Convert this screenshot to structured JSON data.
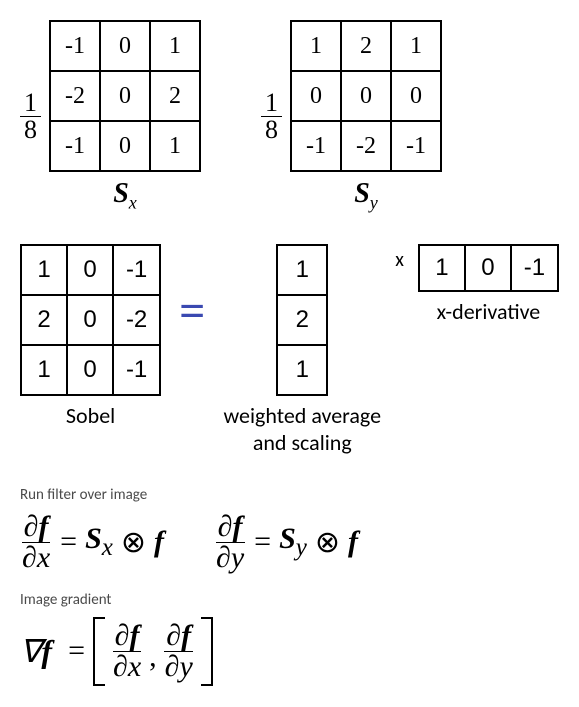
{
  "fraction": {
    "num": "1",
    "den": "8"
  },
  "sx": {
    "label": "S",
    "sub": "x",
    "cells": [
      [
        "-1",
        "0",
        "1"
      ],
      [
        "-2",
        "0",
        "2"
      ],
      [
        "-1",
        "0",
        "1"
      ]
    ]
  },
  "sy": {
    "label": "S",
    "sub": "y",
    "cells": [
      [
        "1",
        "2",
        "1"
      ],
      [
        "0",
        "0",
        "0"
      ],
      [
        "-1",
        "-2",
        "-1"
      ]
    ]
  },
  "sobel": {
    "label": "Sobel",
    "cells": [
      [
        "1",
        "0",
        "-1"
      ],
      [
        "2",
        "0",
        "-2"
      ],
      [
        "1",
        "0",
        "-1"
      ]
    ]
  },
  "decomp": {
    "eq": "=",
    "mult": "x",
    "col": [
      "1",
      "2",
      "1"
    ],
    "col_label": "weighted average and scaling",
    "row": [
      "1",
      "0",
      "-1"
    ],
    "row_label": "x-derivative"
  },
  "headings": {
    "run": "Run filter over image",
    "grad": "Image gradient"
  },
  "eq": {
    "dfdx": {
      "top_d": "∂",
      "top_var": "f",
      "bot_d": "∂",
      "bot_var": "x"
    },
    "dfdy": {
      "top_d": "∂",
      "top_var": "f",
      "bot_d": "∂",
      "bot_var": "y"
    },
    "eq": " = ",
    "otimes": "⊗",
    "Sx": "S",
    "Sx_sub": "x",
    "Sy": "S",
    "Sy_sub": "y",
    "f": "f",
    "nabla": "∇",
    "comma": ","
  },
  "chart_data": [
    {
      "type": "table",
      "title": "Sx kernel (scaled by 1/8)",
      "cells": [
        [
          -1,
          0,
          1
        ],
        [
          -2,
          0,
          2
        ],
        [
          -1,
          0,
          1
        ]
      ]
    },
    {
      "type": "table",
      "title": "Sy kernel (scaled by 1/8)",
      "cells": [
        [
          1,
          2,
          1
        ],
        [
          0,
          0,
          0
        ],
        [
          -1,
          -2,
          -1
        ]
      ]
    },
    {
      "type": "table",
      "title": "Sobel kernel",
      "cells": [
        [
          1,
          0,
          -1
        ],
        [
          2,
          0,
          -2
        ],
        [
          1,
          0,
          -1
        ]
      ]
    },
    {
      "type": "table",
      "title": "Column vector (weighted average and scaling)",
      "cells": [
        [
          1
        ],
        [
          2
        ],
        [
          1
        ]
      ]
    },
    {
      "type": "table",
      "title": "Row vector (x-derivative)",
      "cells": [
        [
          1,
          0,
          -1
        ]
      ]
    }
  ]
}
